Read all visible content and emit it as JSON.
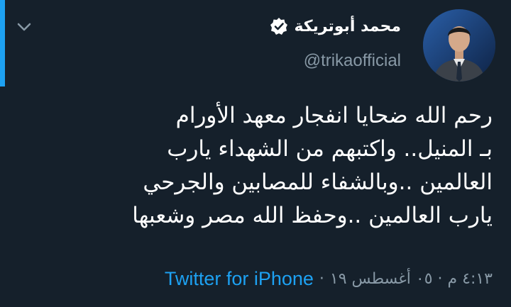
{
  "user": {
    "display_name": "محمد أبوتريكة",
    "handle": "@trikaofficial",
    "verified": true
  },
  "tweet": {
    "lines": [
      "رحم الله ضحايا انفجار معهد الأورام",
      "بـ المنيل.. واكتبهم من الشهداء يارب",
      "العالمين ..وبالشفاء للمصابين والجرحي",
      "يارب العالمين ..وحفظ الله مصر وشعبها"
    ]
  },
  "meta": {
    "timestamp": "٤:١٣ م · ٠٥ أغسطس ١٩",
    "separator": "·",
    "source": "Twitter for iPhone"
  },
  "icons": {
    "collapse": "chevron-down-icon",
    "verified": "verified-badge-icon"
  },
  "colors": {
    "background": "#15202b",
    "accent": "#1da1f2",
    "muted": "#8899a6",
    "text": "#ffffff"
  }
}
